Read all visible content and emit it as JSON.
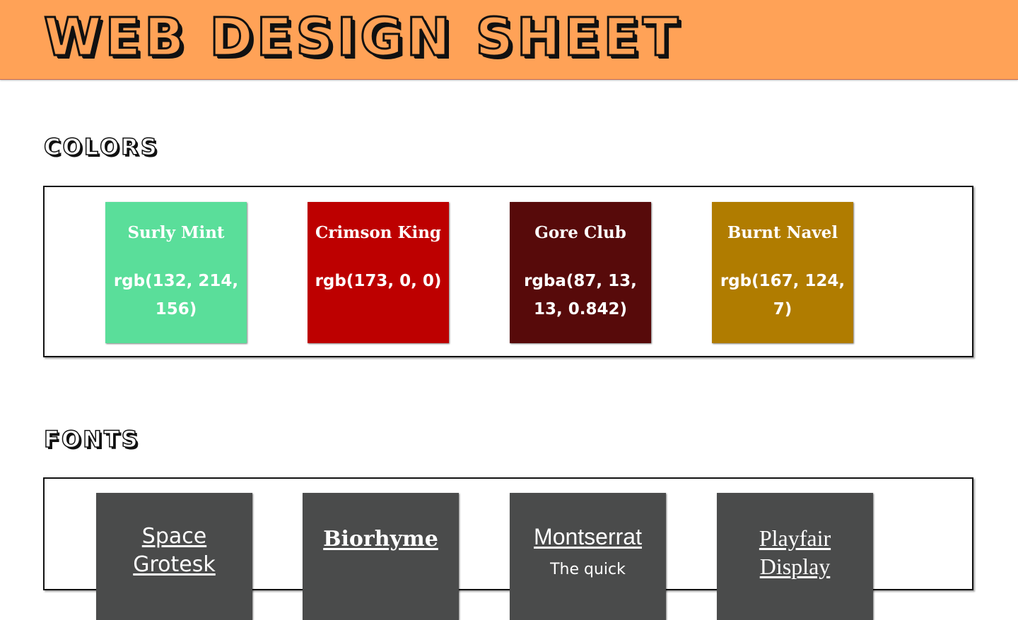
{
  "header": {
    "title": "Web Design Sheet",
    "background_color": "#ffa257"
  },
  "colors_section": {
    "title": "Colors",
    "swatches": [
      {
        "name": "Surly Mint",
        "value": "rgb(132, 214, 156)",
        "color": "#5ade9a"
      },
      {
        "name": "Crimson King",
        "value": "rgb(173, 0, 0)",
        "color": "#bd0000"
      },
      {
        "name": "Gore Club",
        "value": "rgba(87, 13, 13, 0.842)",
        "color": "#570a0a"
      },
      {
        "name": "Burnt Navel",
        "value": "rgb(167, 124, 7)",
        "color": "#b07c00"
      }
    ]
  },
  "fonts_section": {
    "title": "Fonts",
    "cards": [
      {
        "name": "Space Grotesk",
        "sample": ""
      },
      {
        "name": "Biorhyme",
        "sample": ""
      },
      {
        "name": "Montserrat",
        "sample": "The quick"
      },
      {
        "name": "Playfair Display",
        "sample": ""
      }
    ]
  }
}
